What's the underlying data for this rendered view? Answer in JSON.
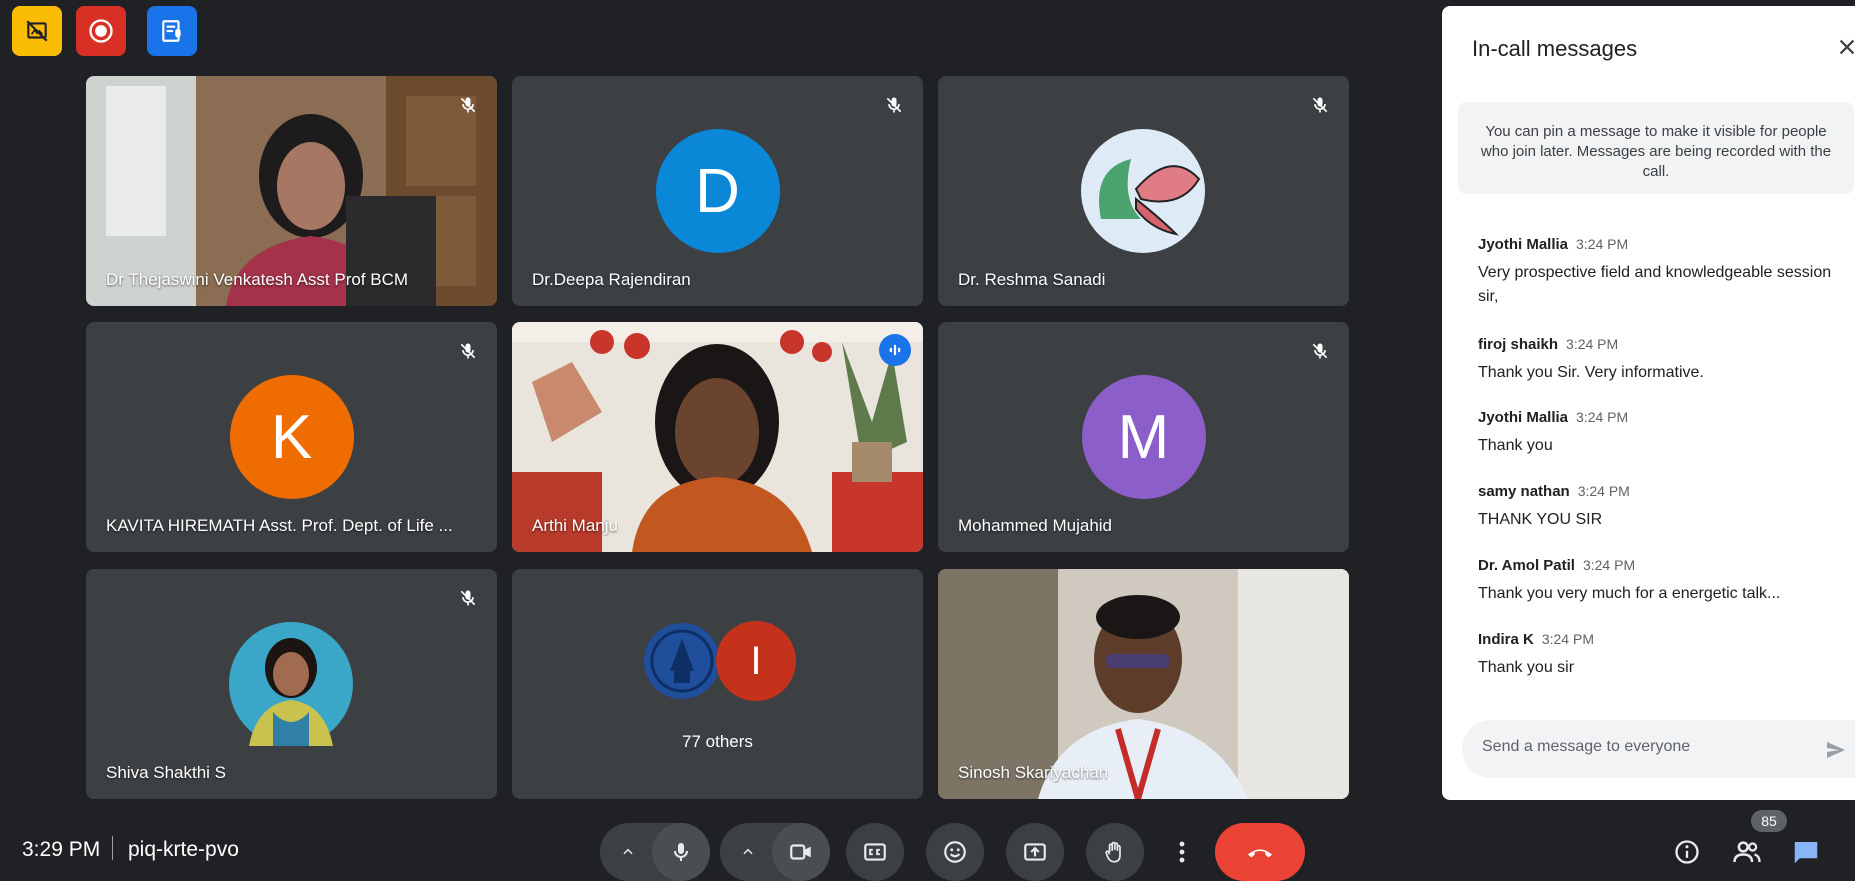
{
  "top_icons": [
    {
      "name": "visual-effects-off-icon",
      "color": "#fbbc04"
    },
    {
      "name": "recording-icon",
      "color": "#d93025"
    },
    {
      "name": "transcript-icon",
      "color": "#1a73e8"
    }
  ],
  "tiles": [
    {
      "name": "Dr Thejaswini Venkatesh Asst Prof BCM",
      "type": "video",
      "muted": true
    },
    {
      "name": "Dr.Deepa Rajendiran",
      "type": "avatar",
      "initial": "D",
      "color": "#0b87d8",
      "muted": true
    },
    {
      "name": "Dr. Reshma Sanadi",
      "type": "photo-avatar",
      "muted": true
    },
    {
      "name": "KAVITA HIREMATH Asst. Prof. Dept. of Life ...",
      "type": "avatar",
      "initial": "K",
      "color": "#ef6c00",
      "muted": true
    },
    {
      "name": "Arthi Manju",
      "type": "video",
      "speaking": true
    },
    {
      "name": "Mohammed Mujahid",
      "type": "avatar",
      "initial": "M",
      "color": "#8c5ec9",
      "muted": true
    },
    {
      "name": "Shiva Shakthi S",
      "type": "photo-avatar",
      "muted": true
    },
    {
      "name": "77 others",
      "type": "others",
      "initial": "I",
      "color": "#c5321b"
    },
    {
      "name": "Sinosh Skariyachan",
      "type": "video"
    }
  ],
  "chat": {
    "title": "In-call messages",
    "pin_note": "You can pin a message to make it visible for people who join later. Messages are being recorded with the call.",
    "messages": [
      {
        "sender": "Jyothi Mallia",
        "time": "3:24 PM",
        "text": "Very prospective field and knowledgeable session sir,"
      },
      {
        "sender": "firoj shaikh",
        "time": "3:24 PM",
        "text": "Thank you Sir. Very informative."
      },
      {
        "sender": "Jyothi Mallia",
        "time": "3:24 PM",
        "text": "Thank you"
      },
      {
        "sender": "samy nathan",
        "time": "3:24 PM",
        "text": "THANK YOU SIR"
      },
      {
        "sender": "Dr. Amol Patil",
        "time": "3:24 PM",
        "text": "Thank you very much for a energetic talk..."
      },
      {
        "sender": "Indira K",
        "time": "3:24 PM",
        "text": "Thank you sir"
      }
    ],
    "input_placeholder": "Send a message to everyone"
  },
  "bottom_bar": {
    "time": "3:29 PM",
    "meeting_code": "piq-krte-pvo",
    "participant_count": "85",
    "end_call_color": "#ea4335"
  }
}
